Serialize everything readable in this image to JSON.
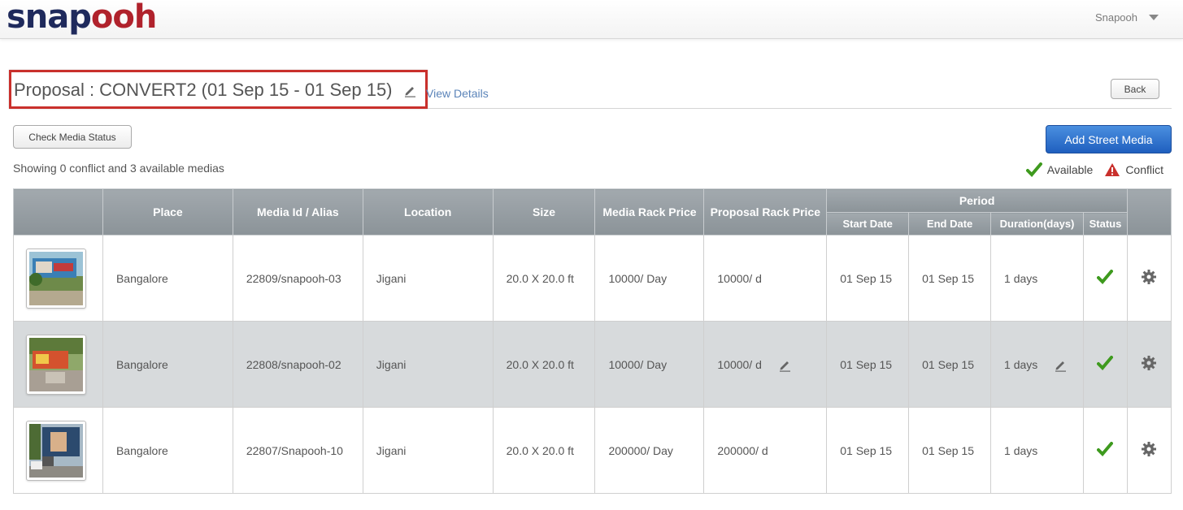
{
  "brand": {
    "part1": "snap",
    "part2": "ooh"
  },
  "user": {
    "name": "Snapooh"
  },
  "proposal": {
    "title": "Proposal : CONVERT2 (01 Sep 15 - 01 Sep 15)",
    "view_details": "View Details"
  },
  "buttons": {
    "back": "Back",
    "check_status": "Check Media Status",
    "add_media": "Add Street Media"
  },
  "summary": "Showing 0 conflict and 3 available medias",
  "legend": {
    "available": "Available",
    "conflict": "Conflict"
  },
  "colors": {
    "brand_dark": "#1f2a5c",
    "brand_red": "#b0222c",
    "available": "#3e9a1e",
    "conflict": "#c9302c",
    "accent_blue": "#2a6fd0"
  },
  "table": {
    "headers": {
      "place": "Place",
      "media_id": "Media Id / Alias",
      "location": "Location",
      "size": "Size",
      "media_rack_price": "Media Rack Price",
      "proposal_rack_price": "Proposal Rack Price",
      "period": "Period",
      "start_date": "Start Date",
      "end_date": "End Date",
      "duration": "Duration(days)",
      "status": "Status"
    },
    "rows": [
      {
        "place": "Bangalore",
        "media_id": "22809/snapooh-03",
        "location": "Jigani",
        "size": "20.0 X 20.0 ft",
        "media_rack_price": "10000/ Day",
        "proposal_rack_price": "10000/ d",
        "start_date": "01 Sep 15",
        "end_date": "01 Sep 15",
        "duration": "1 days",
        "status_icon": "check-icon",
        "settings_icon": "gear-icon"
      },
      {
        "place": "Bangalore",
        "media_id": "22808/snapooh-02",
        "location": "Jigani",
        "size": "20.0 X 20.0 ft",
        "media_rack_price": "10000/ Day",
        "proposal_rack_price": "10000/ d",
        "start_date": "01 Sep 15",
        "end_date": "01 Sep 15",
        "duration": "1 days",
        "status_icon": "check-icon",
        "settings_icon": "gear-icon"
      },
      {
        "place": "Bangalore",
        "media_id": "22807/Snapooh-10",
        "location": "Jigani",
        "size": "20.0 X 20.0 ft",
        "media_rack_price": "200000/ Day",
        "proposal_rack_price": "200000/ d",
        "start_date": "01 Sep 15",
        "end_date": "01 Sep 15",
        "duration": "1 days",
        "status_icon": "check-icon",
        "settings_icon": "gear-icon"
      }
    ]
  }
}
